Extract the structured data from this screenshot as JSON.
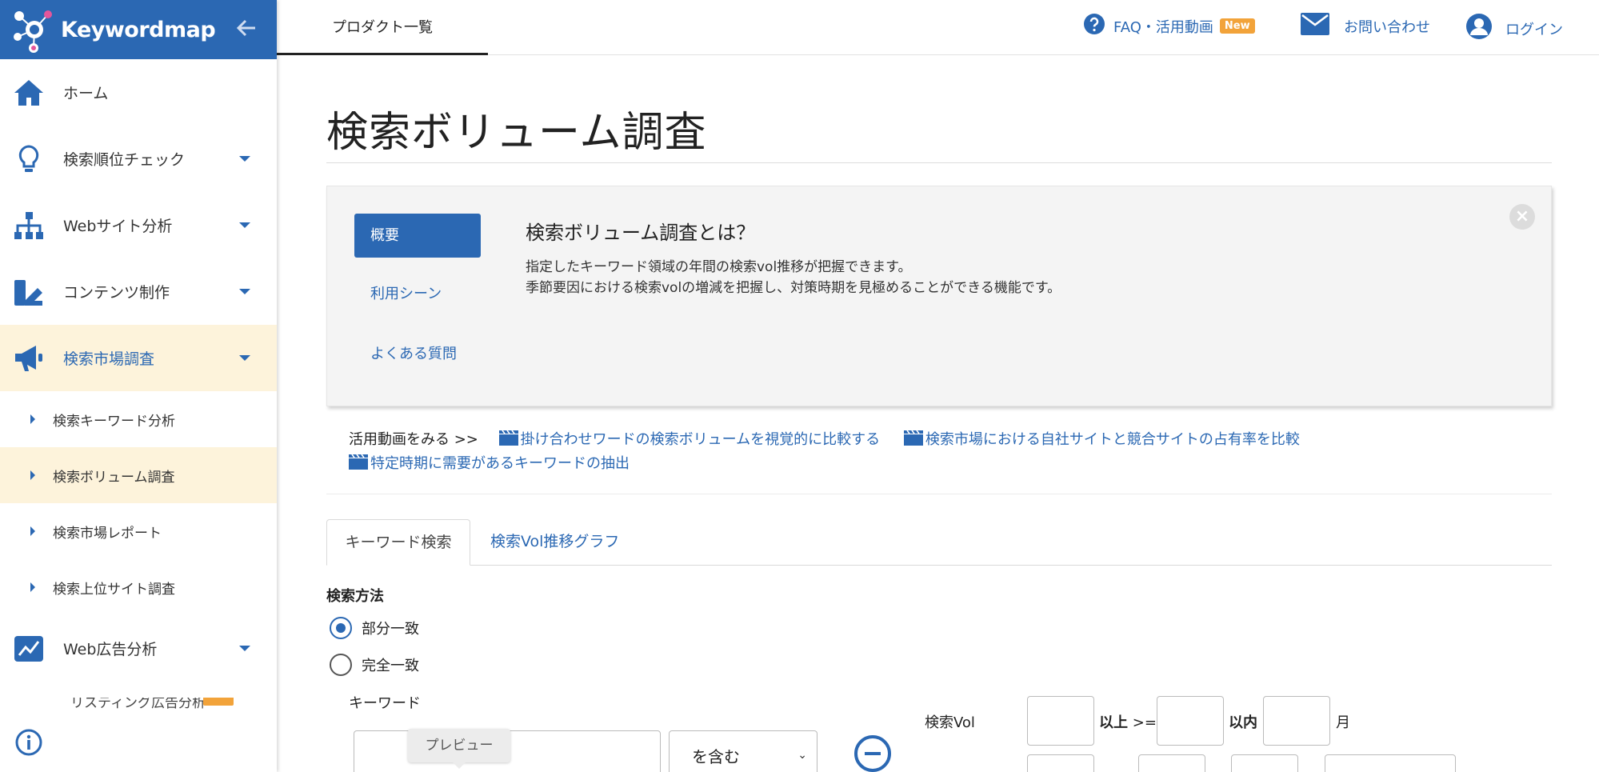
{
  "app": {
    "logo_text": "Keywordmap",
    "collapse_icon": "arrow-left-icon"
  },
  "colors": {
    "primary": "#2b68b3",
    "active_bg": "#fdf3db",
    "new_badge": "#f2a33a"
  },
  "sidebar": {
    "items": [
      {
        "label": "ホーム",
        "icon": "home-icon"
      },
      {
        "label": "検索順位チェック",
        "icon": "lightbulb-icon"
      },
      {
        "label": "Webサイト分析",
        "icon": "sitemap-icon"
      },
      {
        "label": "コンテンツ制作",
        "icon": "content-tools-icon"
      },
      {
        "label": "検索市場調査",
        "icon": "megaphone-icon"
      },
      {
        "label": "Web広告分析",
        "icon": "line-chart-icon"
      }
    ],
    "subitems": [
      {
        "label": "検索キーワード分析"
      },
      {
        "label": "検索ボリューム調査"
      },
      {
        "label": "検索市場レポート"
      },
      {
        "label": "検索上位サイト調査"
      }
    ],
    "partial_subitem": "リスティング広告分析",
    "info_icon": "info-icon"
  },
  "topbar": {
    "products_tab": "プロダクト一覧",
    "faq": "FAQ・活用動画",
    "new_badge": "New",
    "contact": "お問い合わせ",
    "login": "ログイン"
  },
  "main": {
    "title": "検索ボリューム調査",
    "info_panel": {
      "tabs": [
        "概要",
        "利用シーン",
        "よくある質問"
      ],
      "heading": "検索ボリューム調査とは？",
      "desc_line1": "指定したキーワード領域の年間の検索vol推移が把握できます。",
      "desc_line2": "季節要因における検索volの増減を把握し、対策時期を見極めることができる機能です。"
    },
    "videos": {
      "prefix": "活用動画をみる >>",
      "links": [
        "掛け合わせワードの検索ボリュームを視覚的に比較する",
        "検索市場における自社サイトと競合サイトの占有率を比較",
        "特定時期に需要があるキーワードの抽出"
      ]
    },
    "search_tabs": [
      "キーワード検索",
      "検索Vol推移グラフ"
    ],
    "form": {
      "method_label": "検索方法",
      "method_options": [
        "部分一致",
        "完全一致"
      ],
      "keyword_label": "キーワード",
      "preview_tooltip": "プレビュー",
      "match_select": "を含む",
      "vol_label": "検索Vol",
      "over_label": "以上",
      "over_operator": ">=",
      "within_label": "以内",
      "month_label": "月"
    }
  }
}
